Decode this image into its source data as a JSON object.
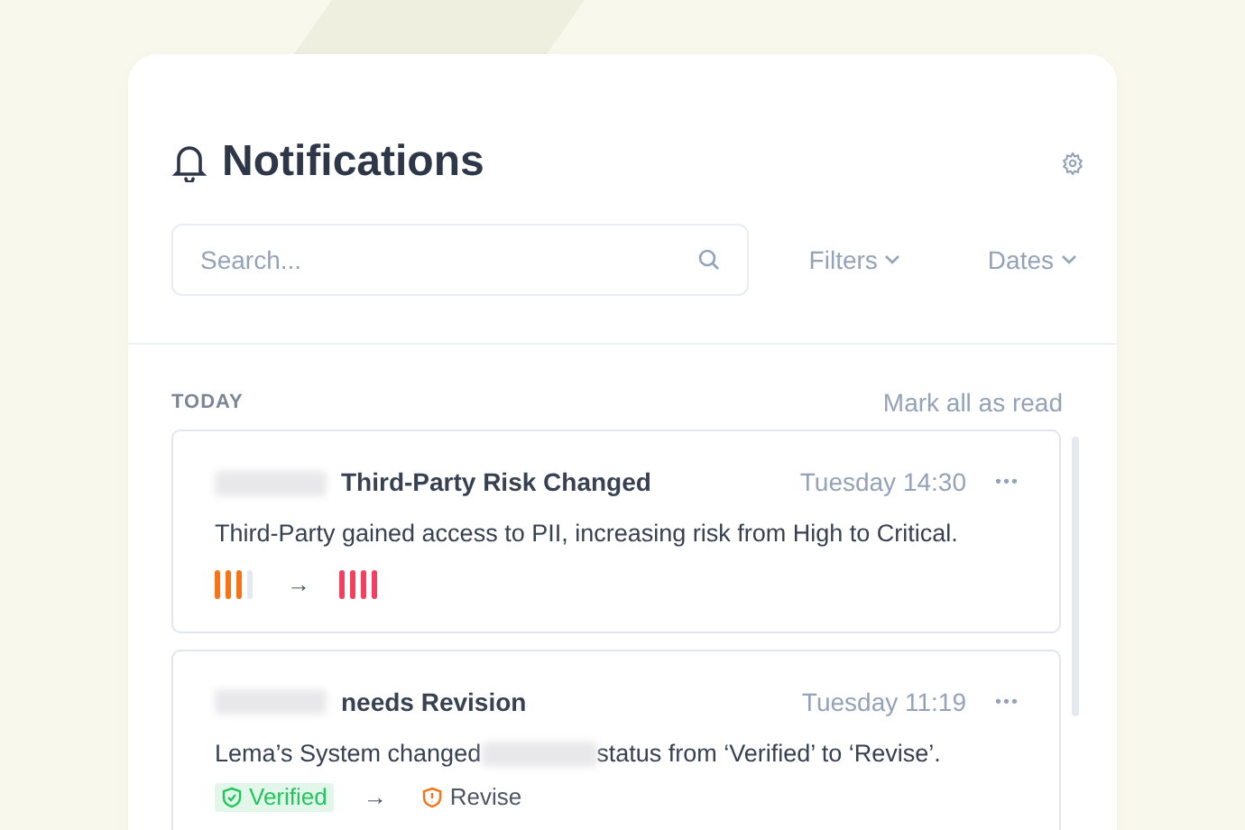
{
  "header": {
    "title": "Notifications"
  },
  "search": {
    "placeholder": "Search..."
  },
  "dropdowns": [
    {
      "label": "Filters"
    },
    {
      "label": "Dates"
    }
  ],
  "section": {
    "label": "TODAY",
    "action": "Mark all as read"
  },
  "notifications": [
    {
      "title_redacted": true,
      "title": "Third-Party Risk Changed",
      "time": "Tuesday 14:30",
      "menu": "•••",
      "body": [
        {
          "kind": "text",
          "text": "Third-Party gained access to PII, increasing risk from High to Critical."
        }
      ],
      "change": {
        "kind": "risk",
        "arrow": "→",
        "from": {
          "level": 0.75,
          "color": "#f97316"
        },
        "to": {
          "level": 1,
          "color": "#f43f5e"
        }
      }
    },
    {
      "title_redacted": true,
      "title": "needs Revision",
      "time": "Tuesday 11:19",
      "menu": "•••",
      "body": [
        {
          "kind": "text",
          "text": "Lema’s System changed"
        },
        {
          "kind": "redacted"
        },
        {
          "kind": "text",
          "text": "status from ‘Verified’ to ‘Revise’."
        }
      ],
      "change": {
        "kind": "status",
        "arrow": "→",
        "from": {
          "label": "Verified",
          "color": "#22c55e",
          "badge": true
        },
        "to": {
          "label": "Revise",
          "color": "#f97316",
          "badge": false
        }
      }
    }
  ]
}
